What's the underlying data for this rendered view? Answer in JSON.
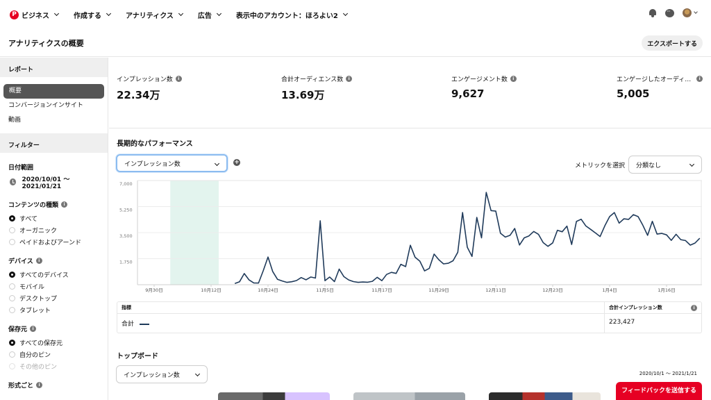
{
  "nav": {
    "business": "ビジネス",
    "create": "作成する",
    "analytics": "アナリティクス",
    "ads": "広告",
    "account": "表示中のアカウント：ほろよい2"
  },
  "header": {
    "title": "アナリティクスの概要",
    "export": "エクスポートする"
  },
  "sidebar": {
    "report_section": "レポート",
    "report_items": [
      "概要",
      "コンバージョンインサイト",
      "動画"
    ],
    "filter_section": "フィルター",
    "date_label": "日付範囲",
    "date_value": "2020/10/01 ～ 2021/01/21",
    "content_type": {
      "label": "コンテンツの種類",
      "options": [
        "すべて",
        "オーガニック",
        "ペイドおよびアーンド"
      ]
    },
    "device": {
      "label": "デバイス",
      "options": [
        "すべてのデバイス",
        "モバイル",
        "デスクトップ",
        "タブレット"
      ]
    },
    "source": {
      "label": "保存元",
      "options": [
        "すべての保存元",
        "自分のピン",
        "その他のピン"
      ]
    },
    "format_label": "形式ごと"
  },
  "metrics": [
    {
      "label": "インプレッション数",
      "value": "22.34万"
    },
    {
      "label": "合計オーディエンス数",
      "value": "13.69万"
    },
    {
      "label": "エンゲージメント数",
      "value": "9,627"
    },
    {
      "label": "エンゲージしたオーディ…",
      "value": "5,005"
    }
  ],
  "performance": {
    "title": "長期的なパフォーマンス",
    "metric_select": "インプレッション数",
    "metric_select_label": "メトリックを選択",
    "breakdown_select": "分類なし"
  },
  "table": {
    "col_metric": "指標",
    "col_total": "合計インプレッション数",
    "row_label": "合計",
    "row_value": "223,427"
  },
  "topboard": {
    "title": "トップボード",
    "select": "インプレッション数",
    "date_range": "2020/10/1 ～ 2021/1/21"
  },
  "feedback": "フィードバックを送信する",
  "chart_data": {
    "type": "line",
    "ylim": [
      0,
      7000
    ],
    "yticks": [
      "1,750",
      "3,500",
      "5,250",
      "7,000"
    ],
    "xticks": [
      "9月30日",
      "10月12日",
      "10月24日",
      "11月5日",
      "11月17日",
      "11月29日",
      "12月11日",
      "12月23日",
      "1月4日",
      "1月16日"
    ],
    "line_color": "#1f3a5a",
    "highlight_color": "#e3f4ee",
    "highlight_range": [
      3.4,
      13.6
    ],
    "x_start_index": 17,
    "values": [
      80,
      200,
      750,
      320,
      120,
      110,
      950,
      1860,
      880,
      360,
      250,
      160,
      200,
      280,
      480,
      330,
      520,
      450,
      4300,
      270,
      520,
      210,
      1050,
      540,
      320,
      210,
      160,
      180,
      170,
      230,
      500,
      270,
      690,
      830,
      760,
      1370,
      1220,
      2650,
      1850,
      1580,
      930,
      1100,
      2060,
      1680,
      1400,
      1440,
      1610,
      2180,
      4850,
      2520,
      1900,
      4520,
      3150,
      6200,
      4980,
      4950,
      3460,
      3200,
      3320,
      3780,
      2670,
      3150,
      3280,
      3580,
      3390,
      2830,
      2580,
      2810,
      3660,
      3560,
      3940,
      2700,
      4250,
      4400,
      3950,
      3720,
      3480,
      3240,
      3970,
      4580,
      4850,
      4140,
      4430,
      4390,
      4710,
      4580,
      4000,
      3320,
      4260,
      3400,
      3450,
      3350,
      2980,
      3390,
      3030,
      2970,
      2660,
      2800,
      3120
    ]
  }
}
